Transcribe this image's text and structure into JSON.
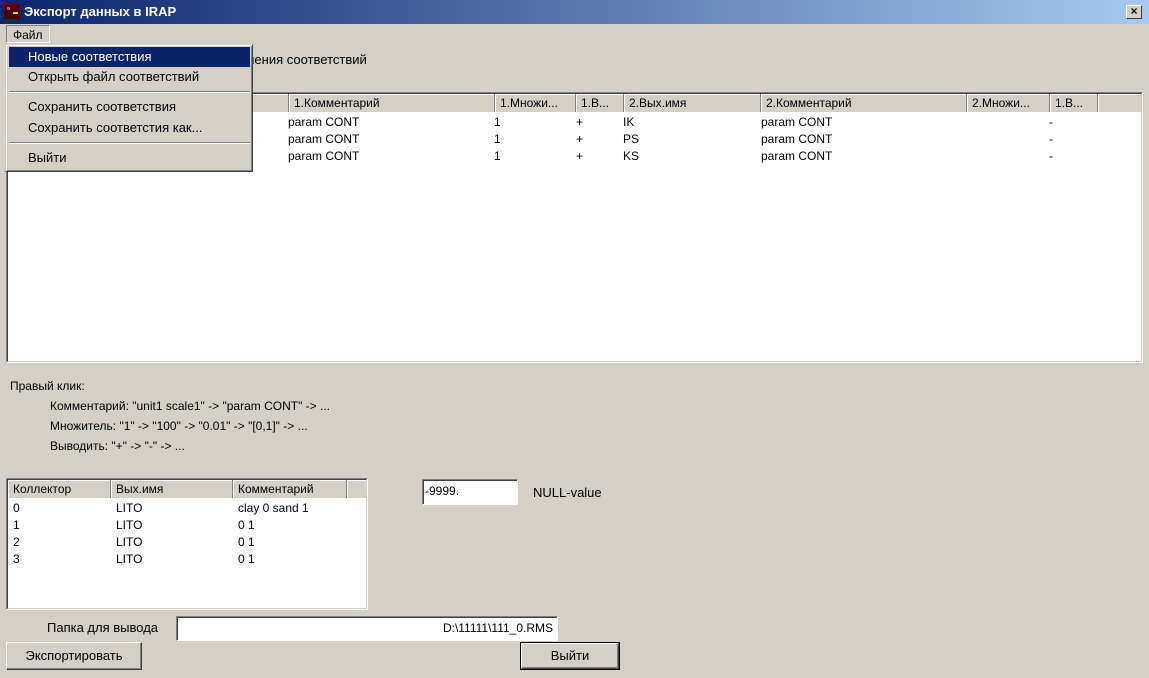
{
  "window": {
    "title": "Экспорт данных в IRAP",
    "close_glyph": "×"
  },
  "menubar": {
    "file_label": "Файл"
  },
  "file_menu": {
    "items": [
      "Новые соответствия",
      "Открыть файл соответствий",
      "Сохранить соответствия",
      "Сохранить соответстия как...",
      "Выйти"
    ]
  },
  "hint_top": "анения соответствий",
  "main_table": {
    "headers": [
      "",
      "1.Комментарий",
      "1.Множи...",
      "1.В...",
      "2.Вых.имя",
      "2.Комментарий",
      "2.Множи...",
      "1.В..."
    ],
    "rows": [
      [
        "",
        "param CONT",
        "1",
        "+",
        "IK",
        "param CONT",
        "",
        "-"
      ],
      [
        "",
        "param CONT",
        "1",
        "+",
        "PS",
        "param CONT",
        "",
        "-"
      ],
      [
        "",
        "param CONT",
        "1",
        "+",
        "KS",
        "param CONT",
        "",
        "-"
      ]
    ]
  },
  "right_click_help": {
    "title": "Правый клик:",
    "lines": [
      "Комментарий: \"unit1 scale1\" -> \"param CONT\" -> ...",
      "Множитель: \"1\" -> \"100\" -> \"0.01\" -> \"[0,1]\" -> ...",
      "Выводить: \"+\" -> \"-\" -> ..."
    ]
  },
  "collector_table": {
    "headers": [
      "Коллектор",
      "Вых.имя",
      "Комментарий"
    ],
    "rows": [
      [
        "0",
        "LITO",
        "clay 0 sand 1"
      ],
      [
        "1",
        "LITO",
        "0 1"
      ],
      [
        "2",
        "LITO",
        "0 1"
      ],
      [
        "3",
        "LITO",
        "0 1"
      ]
    ]
  },
  "null_value": {
    "value": "-9999.",
    "label": "NULL-value"
  },
  "output_folder": {
    "label": "Папка для вывода",
    "value": "D:\\11111\\111_0.RMS"
  },
  "buttons": {
    "export": "Экспортировать",
    "exit": "Выйти"
  }
}
